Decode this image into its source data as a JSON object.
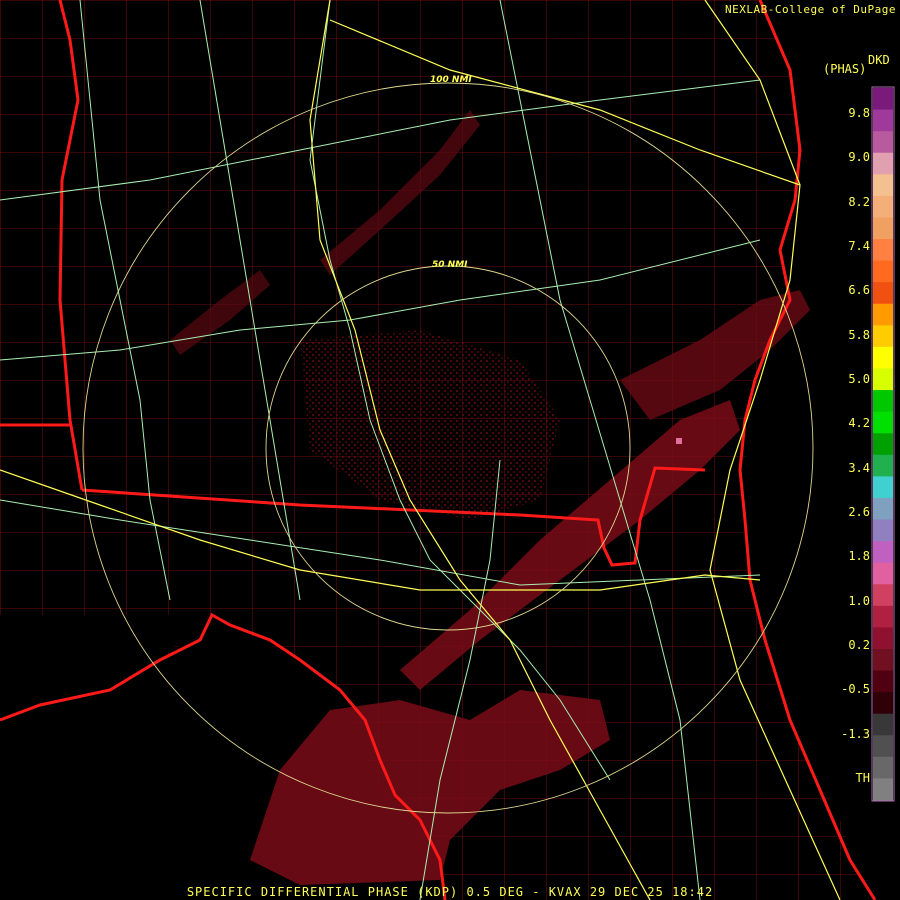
{
  "product": {
    "credit": "NEXLAB-College of DuPage",
    "unit_top": "DKD",
    "unit_sub": "(PHAS)",
    "caption": "SPECIFIC DIFFERENTIAL PHASE (KDP) 0.5 DEG - KVAX 29 DEC 25 18:42",
    "range_rings": [
      "100 NMI",
      "50 NMI"
    ]
  },
  "legend": {
    "labels": [
      "9.8",
      "9.0",
      "8.2",
      "7.4",
      "6.6",
      "5.8",
      "5.0",
      "4.2",
      "3.4",
      "2.6",
      "1.8",
      "1.0",
      "0.2",
      "-0.5",
      "-1.3",
      "TH"
    ],
    "colors": [
      "#7a1a7a",
      "#a03a9a",
      "#b85a9e",
      "#e0a0b0",
      "#f3c08f",
      "#f4ae79",
      "#f0a060",
      "#ff8040",
      "#ff6a1e",
      "#f05010",
      "#ff9a00",
      "#ffcc00",
      "#ffff00",
      "#d8ff00",
      "#00c800",
      "#00e000",
      "#00a000",
      "#20b050",
      "#40d0d0",
      "#80a0c0",
      "#9080c0",
      "#c060c0",
      "#e060a0",
      "#d04060",
      "#b02040",
      "#901030",
      "#701020",
      "#500010",
      "#300008",
      "#383838",
      "#505050",
      "#686868",
      "#808080"
    ]
  },
  "colors": {
    "background": "#000000",
    "state_border": "#ff1a1a",
    "county_border": "#b01818",
    "roads": "#a8f0b0",
    "interstates": "#ffff55",
    "range_ring": "#e0d890",
    "echo": "#6a0a14",
    "text": "#ffff55"
  }
}
